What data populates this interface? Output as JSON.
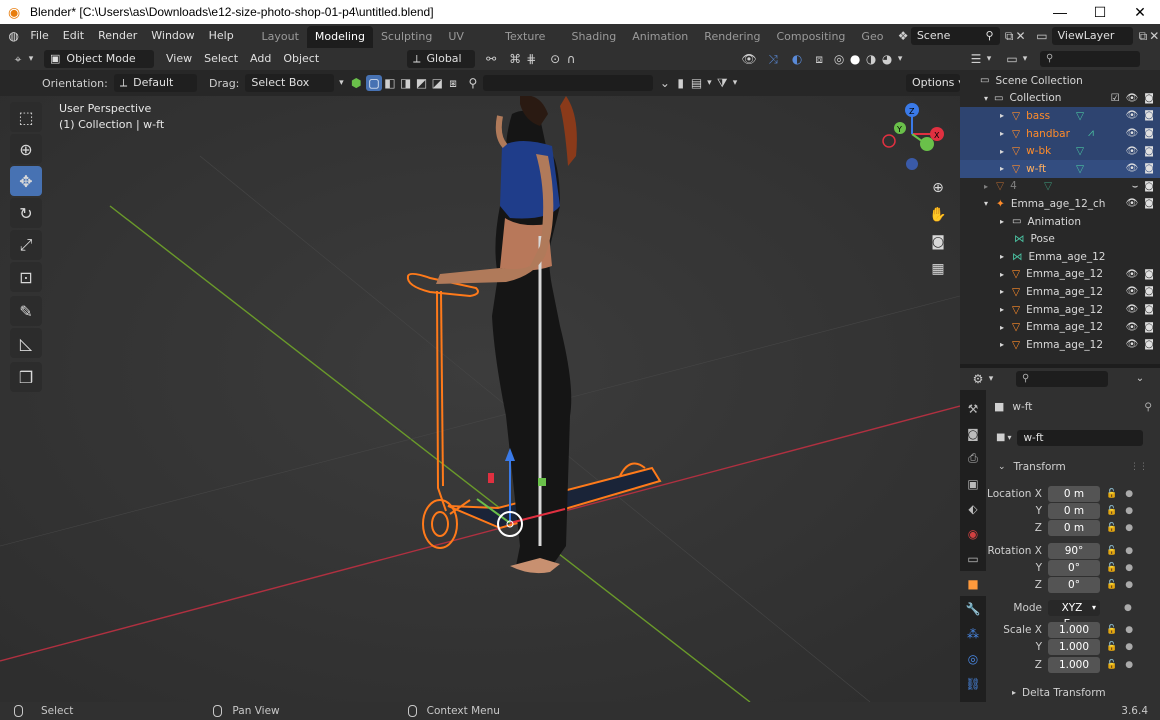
{
  "window": {
    "title": "Blender* [C:\\Users\\as\\Downloads\\e12-size-photo-shop-01-p4\\untitled.blend]",
    "minimize": "—",
    "maximize": "☐",
    "close": "✕"
  },
  "topbar": {
    "menus": [
      "File",
      "Edit",
      "Render",
      "Window",
      "Help"
    ],
    "workspaces": [
      "Layout",
      "Modeling",
      "Sculpting",
      "UV Editing",
      "Texture Paint",
      "Shading",
      "Animation",
      "Rendering",
      "Compositing",
      "Geo"
    ],
    "active_workspace": "Modeling",
    "scene": "Scene",
    "view_layer": "ViewLayer"
  },
  "viewport_header": {
    "mode": "Object Mode",
    "menus": [
      "View",
      "Select",
      "Add",
      "Object"
    ],
    "transform_orientation": "Global"
  },
  "tool_header": {
    "orientation_label": "Orientation:",
    "orientation_value": "Default",
    "drag_label": "Drag:",
    "drag_value": "Select Box",
    "options": "Options"
  },
  "viewport": {
    "perspective": "User Perspective",
    "collection": "(1) Collection | w-ft",
    "gizmo_axes": [
      "X",
      "Y",
      "Z"
    ]
  },
  "outliner": {
    "rows": [
      {
        "name": "Scene Collection",
        "indent": 0
      },
      {
        "name": "Collection",
        "indent": 1
      },
      {
        "name": "bass",
        "indent": 2,
        "orange": true
      },
      {
        "name": "handbar",
        "indent": 2,
        "orange": true
      },
      {
        "name": "w-bk",
        "indent": 2,
        "orange": true
      },
      {
        "name": "w-ft",
        "indent": 2,
        "orange": true
      },
      {
        "name": "4",
        "indent": 2
      },
      {
        "name": "Emma_age_12_ch",
        "indent": 1
      },
      {
        "name": "Animation",
        "indent": 2
      },
      {
        "name": "Pose",
        "indent": 2
      },
      {
        "name": "Emma_age_12",
        "indent": 2
      },
      {
        "name": "Emma_age_12",
        "indent": 2
      },
      {
        "name": "Emma_age_12",
        "indent": 2
      },
      {
        "name": "Emma_age_12",
        "indent": 2
      },
      {
        "name": "Emma_age_12",
        "indent": 2
      },
      {
        "name": "Emma_age_12",
        "indent": 2
      }
    ]
  },
  "properties": {
    "object_name": "w-ft",
    "data_name": "w-ft",
    "panel": "Transform",
    "location_label": "Location X",
    "location": [
      "0 m",
      "0 m",
      "0 m"
    ],
    "rotation_label": "Rotation X",
    "rotation": [
      "90°",
      "0°",
      "0°"
    ],
    "mode_label": "Mode",
    "mode_value": "XYZ E...",
    "scale_label": "Scale X",
    "scale": [
      "1.000",
      "1.000",
      "1.000"
    ],
    "axis_y": "Y",
    "axis_z": "Z",
    "delta_panel": "Delta Transform"
  },
  "statusbar": {
    "select": "Select",
    "pan": "Pan View",
    "context": "Context Menu",
    "version": "3.6.4"
  },
  "colors": {
    "accent": "#4772b3",
    "selected": "#ff8c2a",
    "grid_x": "#b03040",
    "grid_y": "#6a9a2a"
  }
}
